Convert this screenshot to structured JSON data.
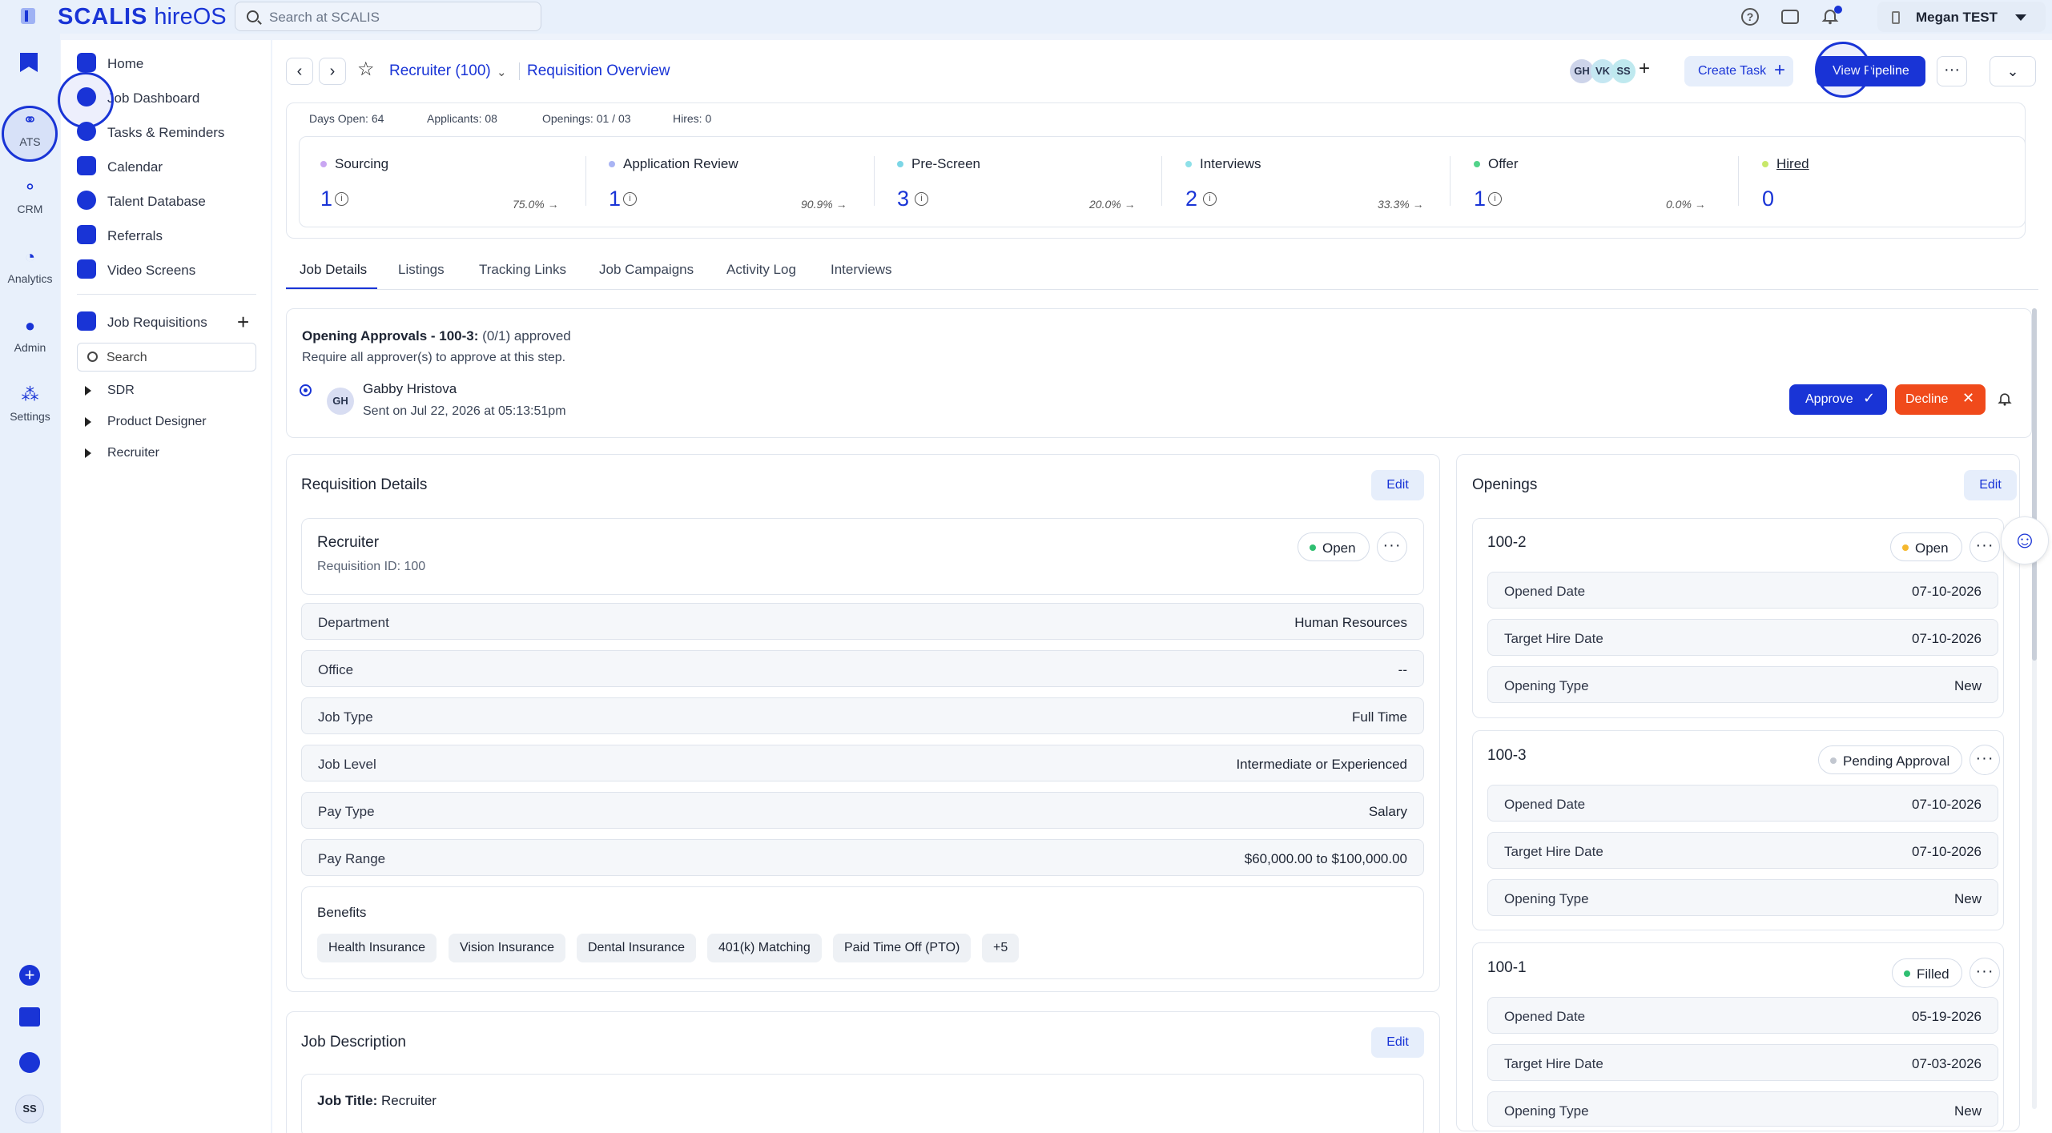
{
  "app": {
    "brand": "SCALIS",
    "product": "hireOS"
  },
  "search": {
    "placeholder": "Search at SCALIS"
  },
  "user": {
    "name": "Megan TEST",
    "initials": "SS"
  },
  "rail": {
    "items": [
      "ATS",
      "CRM",
      "Analytics",
      "Admin",
      "Settings"
    ]
  },
  "nav": {
    "items": [
      "Home",
      "Job Dashboard",
      "Tasks & Reminders",
      "Calendar",
      "Talent Database",
      "Referrals",
      "Video Screens"
    ],
    "requisitions_label": "Job Requisitions",
    "search_placeholder": "Search",
    "tree": [
      "SDR",
      "Product Designer",
      "Recruiter"
    ]
  },
  "header": {
    "job_title": "Recruiter (100)",
    "page_title": "Requisition Overview",
    "team_avatars": [
      "GH",
      "VK",
      "SS"
    ],
    "create_task": "Create Task",
    "view_pipeline": "View Pipeline"
  },
  "stats": {
    "days_open": "Days Open: 64",
    "applicants": "Applicants: 08",
    "openings": "Openings: 01 / 03",
    "hires": "Hires: 0"
  },
  "stages": [
    {
      "name": "Sourcing",
      "count": "1",
      "pct": "75.0% →",
      "color": "#c9a6f2"
    },
    {
      "name": "Application Review",
      "count": "1",
      "pct": "90.9% →",
      "color": "#a9b4f4"
    },
    {
      "name": "Pre-Screen",
      "count": "3",
      "pct": "20.0% →",
      "color": "#7cd6e6"
    },
    {
      "name": "Interviews",
      "count": "2",
      "pct": "33.3% →",
      "color": "#8ee0e8"
    },
    {
      "name": "Offer",
      "count": "1",
      "pct": "0.0% →",
      "color": "#52d38a"
    },
    {
      "name": "Hired",
      "count": "0",
      "pct": "",
      "color": "#c8e86a"
    }
  ],
  "tabs": [
    "Job Details",
    "Listings",
    "Tracking Links",
    "Job Campaigns",
    "Activity Log",
    "Interviews"
  ],
  "approvals": {
    "title": "Opening Approvals - 100-3:",
    "status": "(0/1) approved",
    "subtitle": "Require all approver(s) to approve at this step.",
    "approver_initials": "GH",
    "approver_name": "Gabby Hristova",
    "sent_on": "Sent on Jul 22, 2026 at 05:13:51pm",
    "approve": "Approve",
    "decline": "Decline"
  },
  "requisition": {
    "heading": "Requisition Details",
    "edit": "Edit",
    "name": "Recruiter",
    "id_label": "Requisition ID: 100",
    "status": "Open",
    "fields": [
      {
        "k": "Department",
        "v": "Human Resources"
      },
      {
        "k": "Office",
        "v": "--"
      },
      {
        "k": "Job Type",
        "v": "Full Time"
      },
      {
        "k": "Job Level",
        "v": "Intermediate or Experienced"
      },
      {
        "k": "Pay Type",
        "v": "Salary"
      },
      {
        "k": "Pay Range",
        "v": "$60,000.00 to $100,000.00"
      }
    ],
    "benefits_label": "Benefits",
    "benefits": [
      "Health Insurance",
      "Vision Insurance",
      "Dental Insurance",
      "401(k) Matching",
      "Paid Time Off (PTO)",
      "+5"
    ]
  },
  "openings": {
    "heading": "Openings",
    "edit": "Edit",
    "items": [
      {
        "id": "100-2",
        "status": "Open",
        "status_color": "#f5b82e",
        "opened": "07-10-2026",
        "target": "07-10-2026",
        "type": "New"
      },
      {
        "id": "100-3",
        "status": "Pending Approval",
        "status_color": "#c2c7d0",
        "opened": "07-10-2026",
        "target": "07-10-2026",
        "type": "New"
      },
      {
        "id": "100-1",
        "status": "Filled",
        "status_color": "#2fbf71",
        "opened": "05-19-2026",
        "target": "07-03-2026",
        "type": "New"
      }
    ],
    "labels": {
      "opened": "Opened Date",
      "target": "Target Hire Date",
      "type": "Opening Type"
    }
  },
  "description": {
    "heading": "Job Description",
    "edit": "Edit",
    "job_title_label": "Job Title:",
    "job_title_value": "Recruiter"
  },
  "colors": {
    "accent": "#1934d6",
    "danger": "#f04a1b"
  }
}
